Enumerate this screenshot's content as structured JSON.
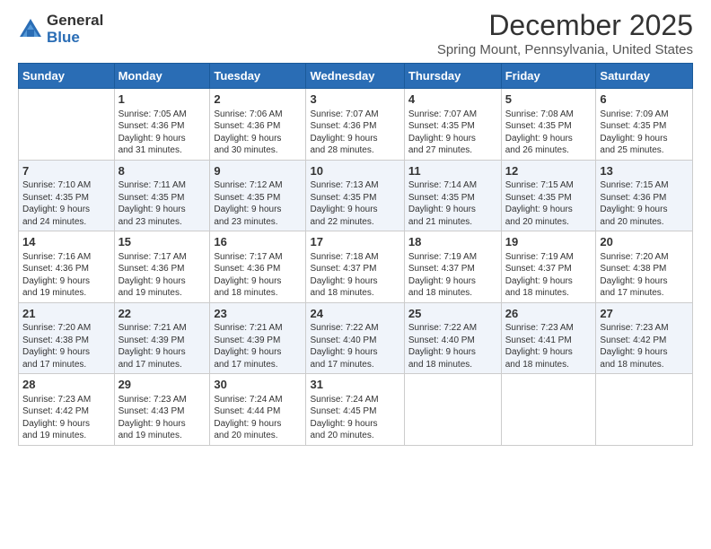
{
  "logo": {
    "general": "General",
    "blue": "Blue"
  },
  "title": "December 2025",
  "subtitle": "Spring Mount, Pennsylvania, United States",
  "days_header": [
    "Sunday",
    "Monday",
    "Tuesday",
    "Wednesday",
    "Thursday",
    "Friday",
    "Saturday"
  ],
  "weeks": [
    [
      {
        "num": "",
        "info": ""
      },
      {
        "num": "1",
        "info": "Sunrise: 7:05 AM\nSunset: 4:36 PM\nDaylight: 9 hours\nand 31 minutes."
      },
      {
        "num": "2",
        "info": "Sunrise: 7:06 AM\nSunset: 4:36 PM\nDaylight: 9 hours\nand 30 minutes."
      },
      {
        "num": "3",
        "info": "Sunrise: 7:07 AM\nSunset: 4:36 PM\nDaylight: 9 hours\nand 28 minutes."
      },
      {
        "num": "4",
        "info": "Sunrise: 7:07 AM\nSunset: 4:35 PM\nDaylight: 9 hours\nand 27 minutes."
      },
      {
        "num": "5",
        "info": "Sunrise: 7:08 AM\nSunset: 4:35 PM\nDaylight: 9 hours\nand 26 minutes."
      },
      {
        "num": "6",
        "info": "Sunrise: 7:09 AM\nSunset: 4:35 PM\nDaylight: 9 hours\nand 25 minutes."
      }
    ],
    [
      {
        "num": "7",
        "info": "Sunrise: 7:10 AM\nSunset: 4:35 PM\nDaylight: 9 hours\nand 24 minutes."
      },
      {
        "num": "8",
        "info": "Sunrise: 7:11 AM\nSunset: 4:35 PM\nDaylight: 9 hours\nand 23 minutes."
      },
      {
        "num": "9",
        "info": "Sunrise: 7:12 AM\nSunset: 4:35 PM\nDaylight: 9 hours\nand 23 minutes."
      },
      {
        "num": "10",
        "info": "Sunrise: 7:13 AM\nSunset: 4:35 PM\nDaylight: 9 hours\nand 22 minutes."
      },
      {
        "num": "11",
        "info": "Sunrise: 7:14 AM\nSunset: 4:35 PM\nDaylight: 9 hours\nand 21 minutes."
      },
      {
        "num": "12",
        "info": "Sunrise: 7:15 AM\nSunset: 4:35 PM\nDaylight: 9 hours\nand 20 minutes."
      },
      {
        "num": "13",
        "info": "Sunrise: 7:15 AM\nSunset: 4:36 PM\nDaylight: 9 hours\nand 20 minutes."
      }
    ],
    [
      {
        "num": "14",
        "info": "Sunrise: 7:16 AM\nSunset: 4:36 PM\nDaylight: 9 hours\nand 19 minutes."
      },
      {
        "num": "15",
        "info": "Sunrise: 7:17 AM\nSunset: 4:36 PM\nDaylight: 9 hours\nand 19 minutes."
      },
      {
        "num": "16",
        "info": "Sunrise: 7:17 AM\nSunset: 4:36 PM\nDaylight: 9 hours\nand 18 minutes."
      },
      {
        "num": "17",
        "info": "Sunrise: 7:18 AM\nSunset: 4:37 PM\nDaylight: 9 hours\nand 18 minutes."
      },
      {
        "num": "18",
        "info": "Sunrise: 7:19 AM\nSunset: 4:37 PM\nDaylight: 9 hours\nand 18 minutes."
      },
      {
        "num": "19",
        "info": "Sunrise: 7:19 AM\nSunset: 4:37 PM\nDaylight: 9 hours\nand 18 minutes."
      },
      {
        "num": "20",
        "info": "Sunrise: 7:20 AM\nSunset: 4:38 PM\nDaylight: 9 hours\nand 17 minutes."
      }
    ],
    [
      {
        "num": "21",
        "info": "Sunrise: 7:20 AM\nSunset: 4:38 PM\nDaylight: 9 hours\nand 17 minutes."
      },
      {
        "num": "22",
        "info": "Sunrise: 7:21 AM\nSunset: 4:39 PM\nDaylight: 9 hours\nand 17 minutes."
      },
      {
        "num": "23",
        "info": "Sunrise: 7:21 AM\nSunset: 4:39 PM\nDaylight: 9 hours\nand 17 minutes."
      },
      {
        "num": "24",
        "info": "Sunrise: 7:22 AM\nSunset: 4:40 PM\nDaylight: 9 hours\nand 17 minutes."
      },
      {
        "num": "25",
        "info": "Sunrise: 7:22 AM\nSunset: 4:40 PM\nDaylight: 9 hours\nand 18 minutes."
      },
      {
        "num": "26",
        "info": "Sunrise: 7:23 AM\nSunset: 4:41 PM\nDaylight: 9 hours\nand 18 minutes."
      },
      {
        "num": "27",
        "info": "Sunrise: 7:23 AM\nSunset: 4:42 PM\nDaylight: 9 hours\nand 18 minutes."
      }
    ],
    [
      {
        "num": "28",
        "info": "Sunrise: 7:23 AM\nSunset: 4:42 PM\nDaylight: 9 hours\nand 19 minutes."
      },
      {
        "num": "29",
        "info": "Sunrise: 7:23 AM\nSunset: 4:43 PM\nDaylight: 9 hours\nand 19 minutes."
      },
      {
        "num": "30",
        "info": "Sunrise: 7:24 AM\nSunset: 4:44 PM\nDaylight: 9 hours\nand 20 minutes."
      },
      {
        "num": "31",
        "info": "Sunrise: 7:24 AM\nSunset: 4:45 PM\nDaylight: 9 hours\nand 20 minutes."
      },
      {
        "num": "",
        "info": ""
      },
      {
        "num": "",
        "info": ""
      },
      {
        "num": "",
        "info": ""
      }
    ]
  ]
}
